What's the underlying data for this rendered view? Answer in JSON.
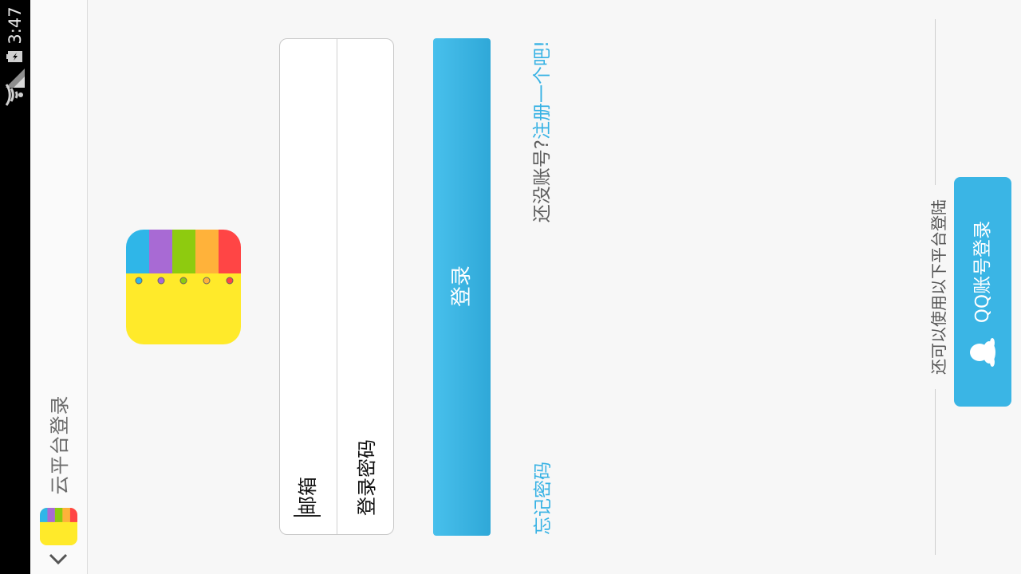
{
  "status_bar": {
    "time": "3:47",
    "icons": [
      "wifi-icon",
      "signal-icon",
      "battery-charging-icon"
    ]
  },
  "action_bar": {
    "title": "云平台登录",
    "up_icon": "chevron-down-icon",
    "logo_icon": "app-logo-icon"
  },
  "app_icon": {
    "name": "app-logo-icon",
    "stripe_colors": [
      "#2fb6e8",
      "#a86ad4",
      "#8ecb0f",
      "#ffb23a",
      "#ff4545"
    ],
    "body_color": "#ffea2a"
  },
  "form": {
    "email_label": "邮箱",
    "password_label": "登录密码"
  },
  "login_button": {
    "label": "登录",
    "color": "#3db4e4"
  },
  "links": {
    "register_prefix": "还没账号?",
    "register_action": "注册一个吧!",
    "forgot_password": "忘记密码",
    "accent": "#37b2e4"
  },
  "other_login": {
    "label": "还可以使用以下平台登陆",
    "qq_button_label": "QQ账号登录",
    "qq_icon": "qq-penguin-icon",
    "qq_color": "#3ab5e5"
  }
}
